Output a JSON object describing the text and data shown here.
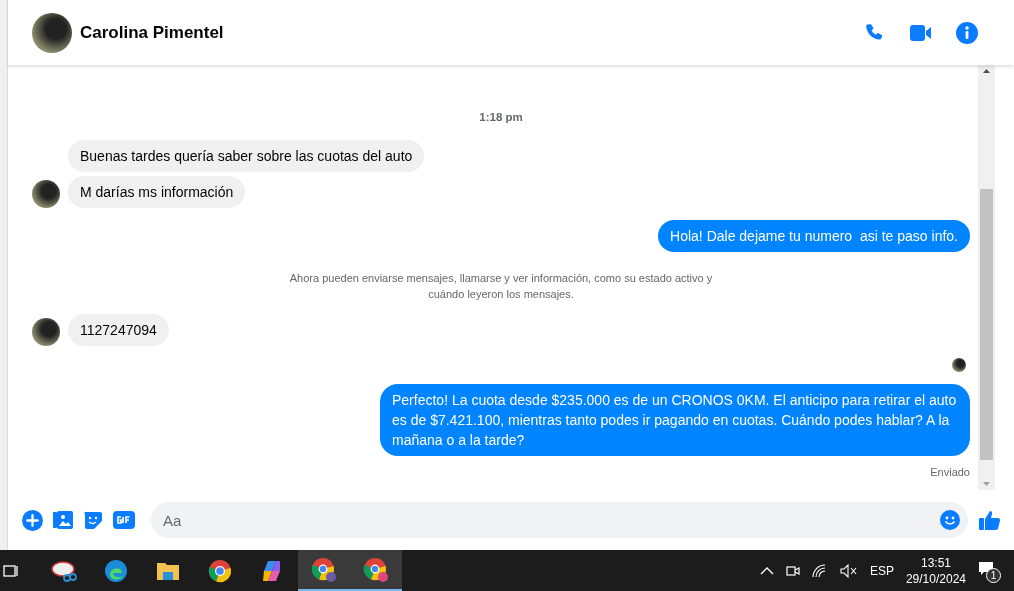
{
  "header": {
    "contact_name": "Carolina Pimentel"
  },
  "messages": [
    {
      "kind": "time",
      "text": "1:18 pm"
    },
    {
      "kind": "incoming",
      "text": "Buenas tardes quería saber sobre las cuotas del auto",
      "avatar": false
    },
    {
      "kind": "incoming",
      "text": "M darías ms información",
      "avatar": true
    },
    {
      "kind": "outgoing",
      "text": "Hola! Dale dejame tu numero  asi te paso info."
    },
    {
      "kind": "system",
      "text": "Ahora pueden enviarse mensajes, llamarse y ver información, como su estado activo y cuándo leyeron los mensajes."
    },
    {
      "kind": "incoming",
      "text": "1127247094",
      "avatar": true
    },
    {
      "kind": "seen"
    },
    {
      "kind": "outgoing",
      "text": "Perfecto! La cuota desde $235.000 es de un CRONOS 0KM. El anticipo para retirar el auto es de $7.421.100, mientras tanto podes ir pagando en cuotas. Cuándo podes hablar? A la mañana o a la tarde?"
    },
    {
      "kind": "status",
      "text": "Enviado"
    }
  ],
  "composer": {
    "placeholder": "Aa"
  },
  "taskbar": {
    "language": "ESP",
    "time": "13:51",
    "date": "29/10/2024",
    "notifications": "1"
  }
}
